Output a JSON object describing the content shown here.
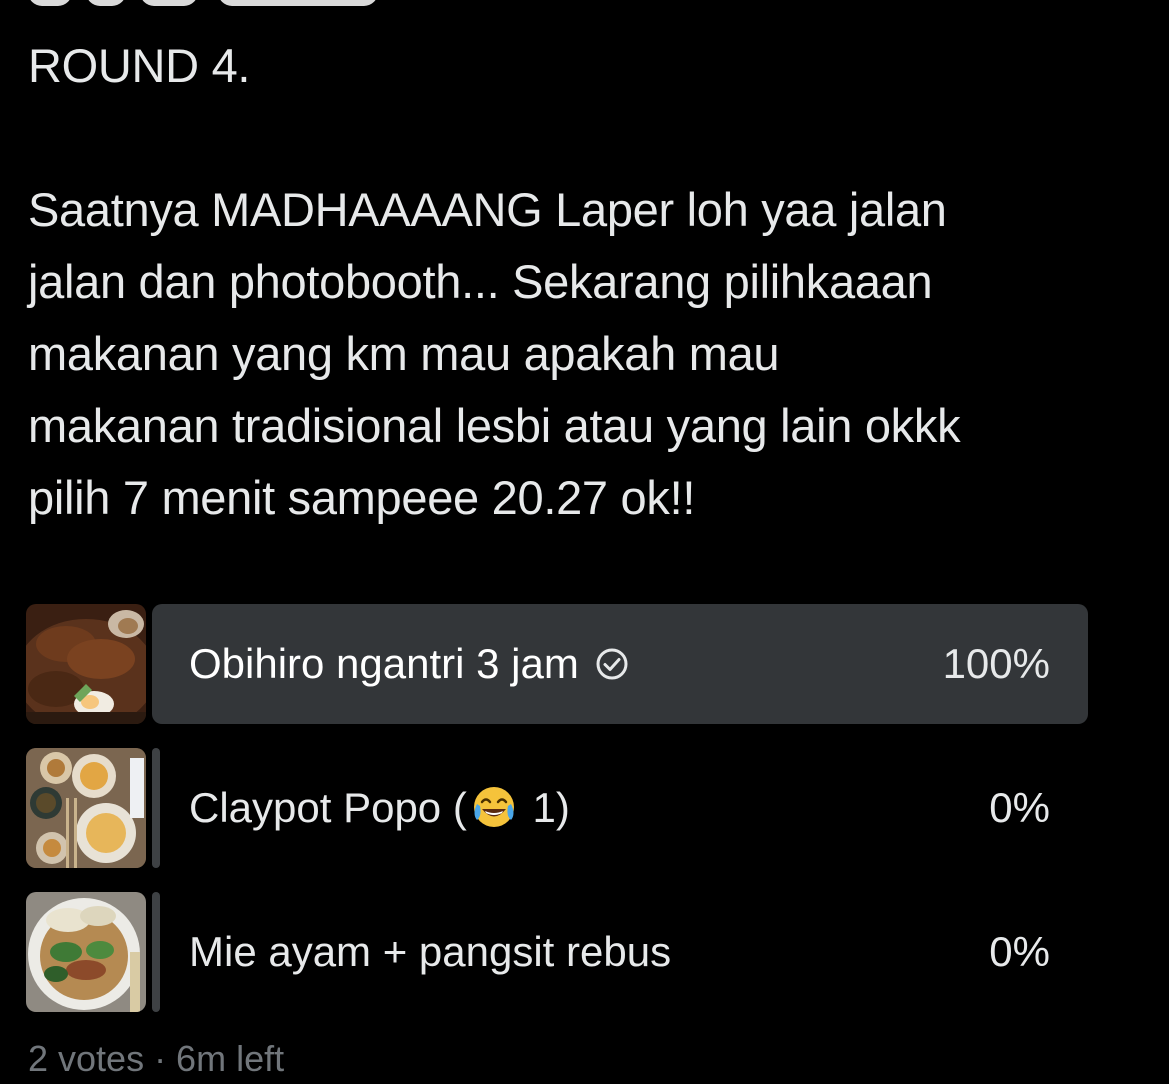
{
  "tweet": {
    "title_line": "ROUND 4.",
    "body_lines": [
      "Saatnya MADHAAAANG Laper loh yaa jalan",
      "jalan dan photobooth... Sekarang pilihkaaan",
      "makanan yang km mau apakah mau",
      "makanan tradisional lesbi atau yang lain okkk",
      "pilih 7 menit sampeee 20.27 ok!!"
    ]
  },
  "poll": {
    "options": [
      {
        "label": "Obihiro ngantri 3 jam",
        "percent_text": "100%",
        "percent": 100,
        "winner": true,
        "icon": "check-circle-icon"
      },
      {
        "label_before": "Claypot Popo (",
        "emoji": "face-with-tears-of-joy",
        "label_after": " 1)",
        "percent_text": "0%",
        "percent": 0,
        "winner": false
      },
      {
        "label": "Mie ayam + pangsit rebus",
        "percent_text": "0%",
        "percent": 0,
        "winner": false
      }
    ],
    "meta": "2 votes · 6m left"
  },
  "colors": {
    "background": "#000000",
    "text": "#e7e9ea",
    "winner_bar": "#333639",
    "muted": "#71767b"
  }
}
